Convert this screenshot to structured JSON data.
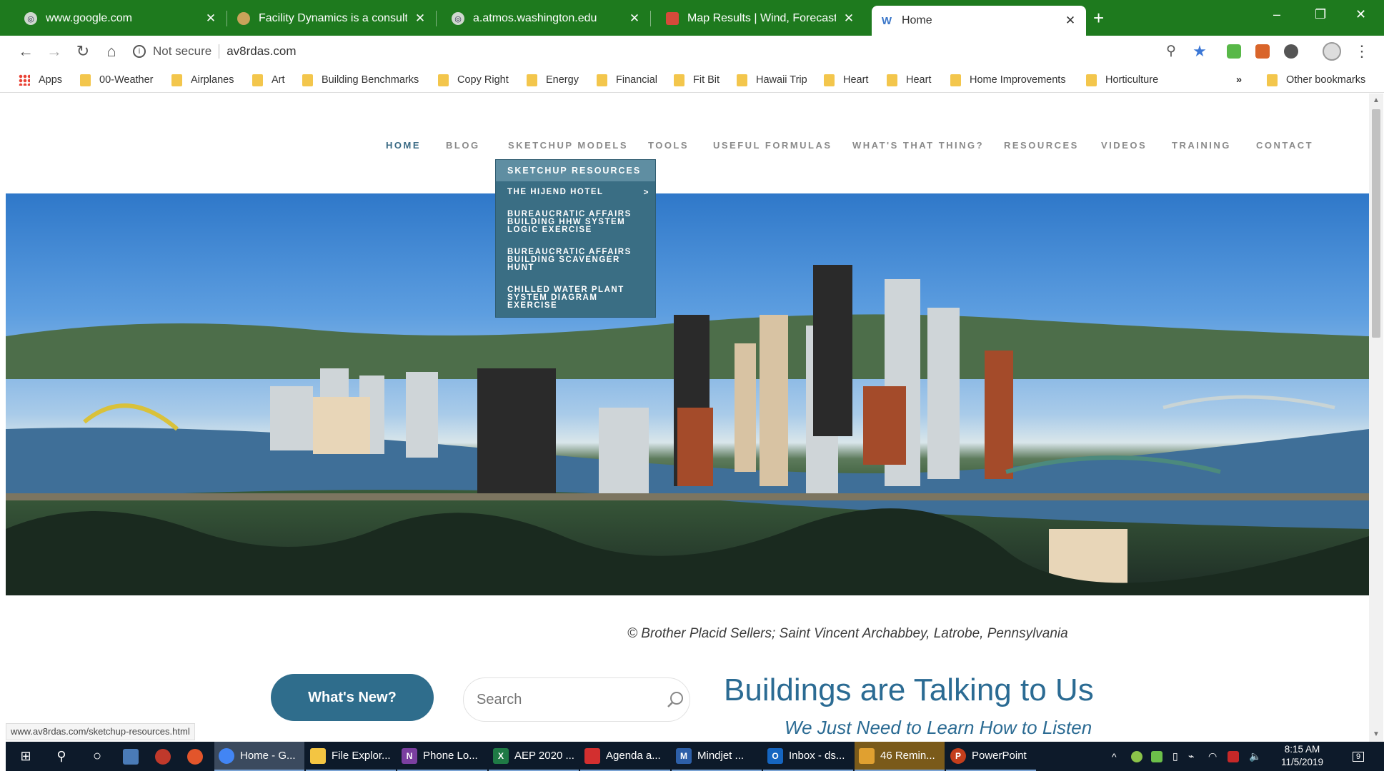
{
  "browser": {
    "tabs": [
      {
        "title": "www.google.com",
        "active": false
      },
      {
        "title": "Facility Dynamics is a consulting",
        "active": false
      },
      {
        "title": "a.atmos.washington.edu",
        "active": false
      },
      {
        "title": "Map Results | Wind, Forecast, Ra",
        "active": false
      },
      {
        "title": "Home",
        "active": true
      }
    ],
    "new_tab": "+",
    "security_label": "Not secure",
    "url": "av8rdas.com",
    "bookmarks": [
      "Apps",
      "00-Weather",
      "Airplanes",
      "Art",
      "Building Benchmarks",
      "Copy Right",
      "Energy",
      "Financial",
      "Fit Bit",
      "Hawaii Trip",
      "Heart",
      "Heart",
      "Home Improvements",
      "Horticulture"
    ],
    "more_bookmarks": "»",
    "other_bookmarks": "Other bookmarks",
    "status_url": "www.av8rdas.com/sketchup-resources.html"
  },
  "site": {
    "nav": [
      "HOME",
      "BLOG",
      "SKETCHUP MODELS",
      "TOOLS",
      "USEFUL FORMULAS",
      "WHAT'S THAT THING?",
      "RESOURCES",
      "VIDEOS",
      "TRAINING",
      "CONTACT"
    ],
    "current_nav": "HOME",
    "dropdown": {
      "header": "SKETCHUP RESOURCES",
      "items": [
        {
          "label": "THE HIJEND HOTEL",
          "has_submenu": true
        },
        {
          "label": "BUREAUCRATIC AFFAIRS BUILDING HHW SYSTEM LOGIC EXERCISE",
          "has_submenu": false
        },
        {
          "label": "BUREAUCRATIC AFFAIRS BUILDING SCAVENGER HUNT",
          "has_submenu": false
        },
        {
          "label": "CHILLED WATER PLANT SYSTEM DIAGRAM EXERCISE",
          "has_submenu": false
        }
      ],
      "submenu_arrow": ">"
    },
    "caption": "© Brother Placid Sellers;  Saint Vincent Archabbey, Latrobe, Pennsylvania",
    "whats_new_button": "What's New?",
    "search_placeholder": "Search",
    "headline": "Buildings are Talking to Us",
    "subheadline": "We Just Need to Learn How to Listen"
  },
  "taskbar": {
    "items": [
      "Home - G...",
      "File Explor...",
      "Phone Lo...",
      "AEP 2020 ...",
      "Agenda a...",
      "Mindjet ...",
      "Inbox - ds...",
      "46 Remin...",
      "PowerPoint"
    ],
    "time": "8:15 AM",
    "date": "11/5/2019",
    "notifications": "9"
  },
  "colors": {
    "tabstrip": "#1e7a1e",
    "accent_blue": "#2b6b93",
    "dropdown_bg": "#3a6e84",
    "button_bg": "#2f6d8c",
    "taskbar": "#0d1a2a"
  }
}
